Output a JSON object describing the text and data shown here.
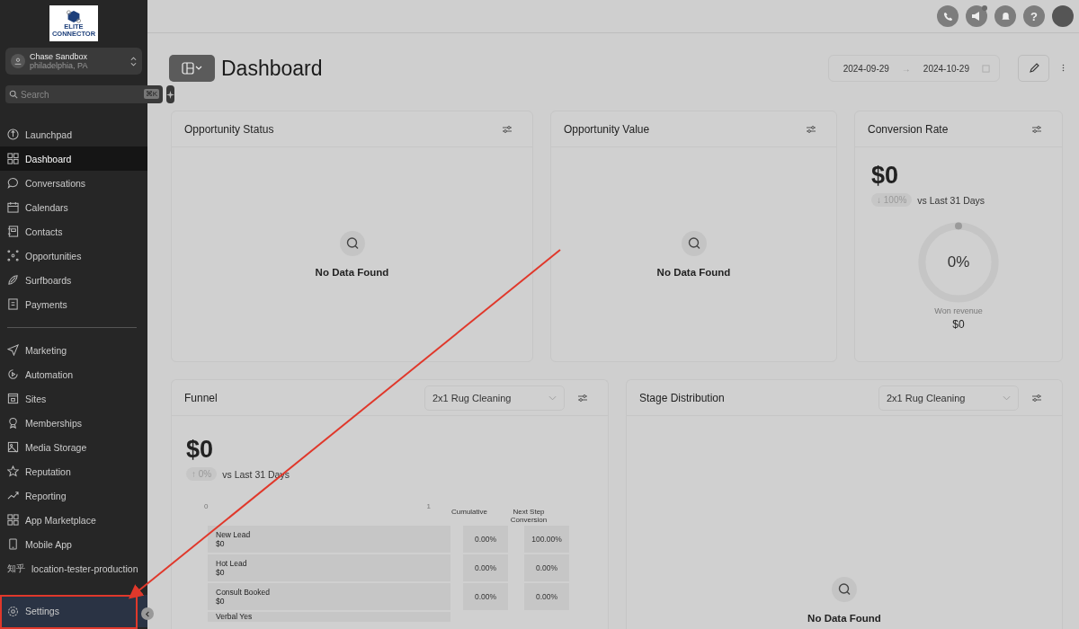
{
  "sidebar": {
    "logo": {
      "line1": "ELITE",
      "line2": "CONNECTOR"
    },
    "account": {
      "name": "Chase Sandbox",
      "location": "philadelphia, PA"
    },
    "search": {
      "placeholder": "Search",
      "shortcut": "⌘K"
    },
    "nav_groups": [
      [
        {
          "label": "Launchpad",
          "selected": false
        },
        {
          "label": "Dashboard",
          "selected": true
        },
        {
          "label": "Conversations",
          "selected": false
        },
        {
          "label": "Calendars",
          "selected": false
        },
        {
          "label": "Contacts",
          "selected": false
        },
        {
          "label": "Opportunities",
          "selected": false
        },
        {
          "label": "Surfboards",
          "selected": false
        },
        {
          "label": "Payments",
          "selected": false
        }
      ],
      [
        {
          "label": "Marketing",
          "selected": false
        },
        {
          "label": "Automation",
          "selected": false
        },
        {
          "label": "Sites",
          "selected": false
        },
        {
          "label": "Memberships",
          "selected": false
        },
        {
          "label": "Media Storage",
          "selected": false
        },
        {
          "label": "Reputation",
          "selected": false
        },
        {
          "label": "Reporting",
          "selected": false
        },
        {
          "label": "App Marketplace",
          "selected": false
        },
        {
          "label": "Mobile App",
          "selected": false
        },
        {
          "label": "location-tester-production",
          "selected": false,
          "prefix": "知乎"
        }
      ]
    ],
    "settings": {
      "label": "Settings",
      "selected": false
    }
  },
  "topbar": {
    "help": "?",
    "notification_dot": true
  },
  "header": {
    "title": "Dashboard",
    "date_from": "2024-09-29",
    "arrow": "→",
    "date_to": "2024-10-29"
  },
  "cards": [
    {
      "title": "Opportunity Status",
      "empty": "No Data Found"
    },
    {
      "title": "Opportunity Value",
      "empty": "No Data Found"
    },
    {
      "title": "Conversion Rate",
      "amount": "$0",
      "change": "↓ 100%",
      "compare": "vs Last 31 Days",
      "level": 0,
      "gauge_value": "0%",
      "gauge_label": "Won revenue",
      "gauge_amount": "$0"
    }
  ],
  "funnel": {
    "title": "Funnel",
    "pipeline": "2x1 Rug Cleaning",
    "amount": "$0",
    "change": "↑ 0%",
    "compare": "vs Last 31 Days",
    "axis_min": "0",
    "axis_max": "1",
    "col_cumulative": "Cumulative",
    "col_next": "Next Step Conversion",
    "rows": [
      {
        "stage": "New Lead",
        "value": "$0",
        "cumulative": "0.00%",
        "next": "100.00%"
      },
      {
        "stage": "Hot Lead",
        "value": "$0",
        "cumulative": "0.00%",
        "next": "0.00%"
      },
      {
        "stage": "Consult Booked",
        "value": "$0",
        "cumulative": "0.00%",
        "next": "0.00%"
      },
      {
        "stage": "Verbal Yes"
      }
    ]
  },
  "stage_distribution": {
    "title": "Stage Distribution",
    "pipeline": "2x1 Rug Cleaning",
    "empty": "No Data Found"
  },
  "annotation": {
    "arrow": true,
    "highlight": true
  }
}
